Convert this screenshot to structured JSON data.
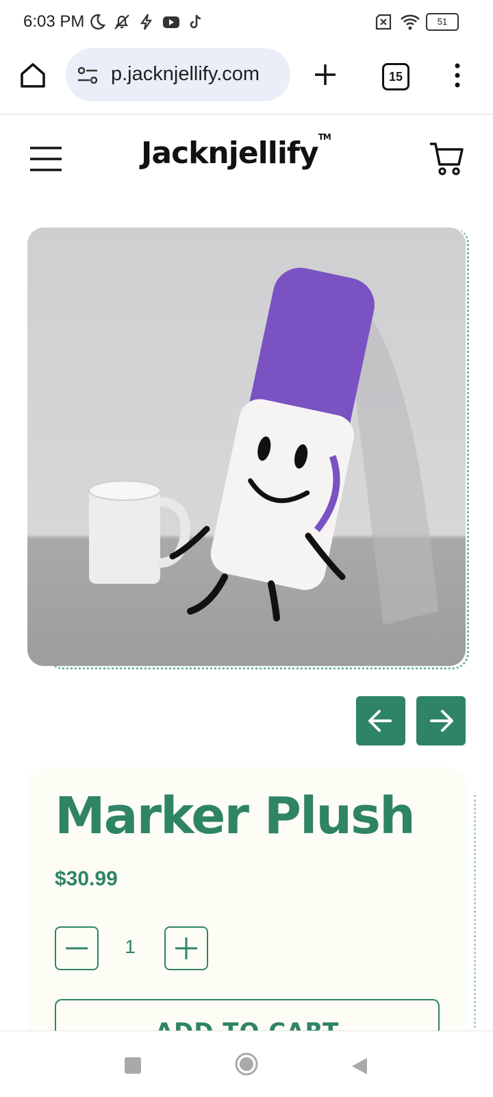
{
  "status_bar": {
    "time": "6:03 PM",
    "left_icons": [
      "moon-icon",
      "bell-off-icon",
      "flash-icon",
      "youtube-icon",
      "tiktok-icon"
    ],
    "right_icons": [
      "sim-off-icon",
      "wifi-icon",
      "battery-icon"
    ],
    "battery_level": "51"
  },
  "browser": {
    "url_visible": "p.jacknjellify.com",
    "url_fade_prefix": "",
    "tab_count": "15"
  },
  "site": {
    "logo": "Jacknjellify",
    "logo_tm": "TM"
  },
  "product": {
    "title": "Marker Plush",
    "price": "$30.99",
    "quantity": "1",
    "add_to_cart_label": "ADD TO CART"
  },
  "colors": {
    "brand_green": "#2f8466",
    "card_bg": "#fdfcf5",
    "url_pill_bg": "#e9eef8"
  }
}
